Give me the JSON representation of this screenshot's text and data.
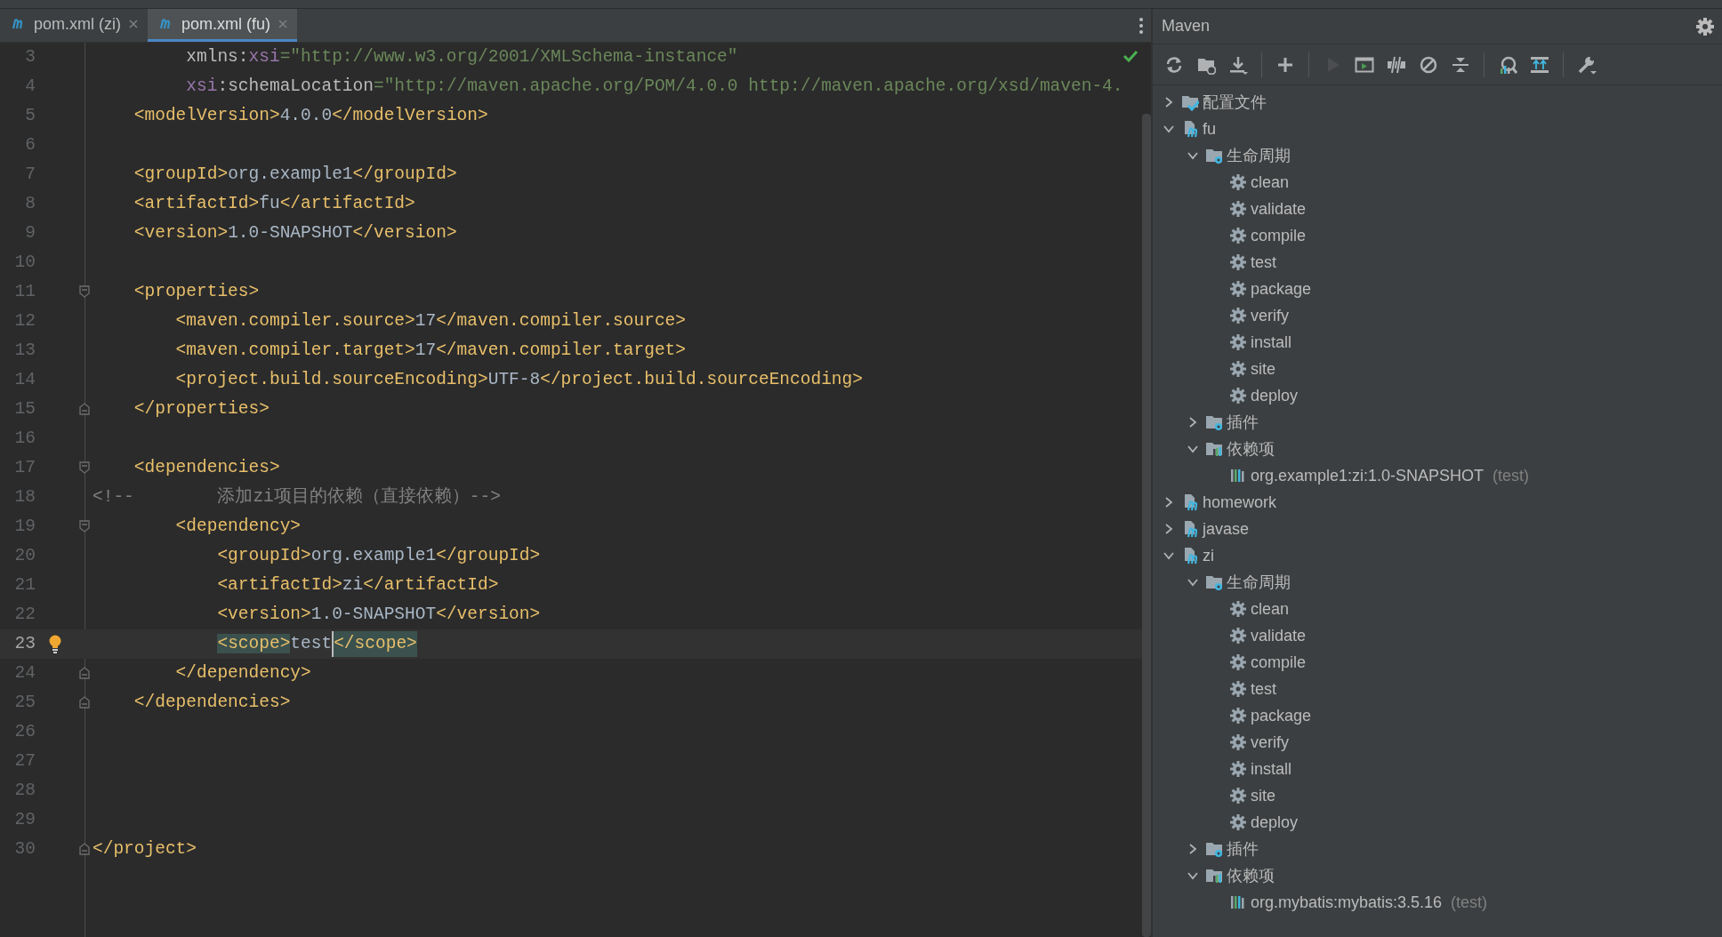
{
  "tabs": [
    {
      "label": "pom.xml (zi)",
      "selected": false
    },
    {
      "label": "pom.xml (fu)",
      "selected": true
    }
  ],
  "editor": {
    "lines": [
      {
        "number": "3",
        "tokens": [
          {
            "kind": "attr",
            "text": "         xmlns:"
          },
          {
            "kind": "ns",
            "text": "xsi"
          },
          {
            "kind": "str",
            "text": "=\"http://www.w3.org/2001/XMLSchema-instance\""
          }
        ]
      },
      {
        "number": "4",
        "tokens": [
          {
            "kind": "ns",
            "text": "         xsi"
          },
          {
            "kind": "attr",
            "text": ":schemaLocation"
          },
          {
            "kind": "str",
            "text": "=\"http://maven.apache.org/POM/4.0.0 http://maven.apache.org/xsd/maven-4."
          }
        ]
      },
      {
        "number": "5",
        "tokens": [
          {
            "kind": "tag",
            "text": "    <modelVersion>"
          },
          {
            "kind": "text",
            "text": "4.0.0"
          },
          {
            "kind": "tag",
            "text": "</modelVersion>"
          }
        ]
      },
      {
        "number": "6"
      },
      {
        "number": "7",
        "tokens": [
          {
            "kind": "tag",
            "text": "    <groupId>"
          },
          {
            "kind": "text",
            "text": "org.example1"
          },
          {
            "kind": "tag",
            "text": "</groupId>"
          }
        ]
      },
      {
        "number": "8",
        "tokens": [
          {
            "kind": "tag",
            "text": "    <artifactId>"
          },
          {
            "kind": "text",
            "text": "fu"
          },
          {
            "kind": "tag",
            "text": "</artifactId>"
          }
        ]
      },
      {
        "number": "9",
        "tokens": [
          {
            "kind": "tag",
            "text": "    <version>"
          },
          {
            "kind": "text",
            "text": "1.0-SNAPSHOT"
          },
          {
            "kind": "tag",
            "text": "</version>"
          }
        ]
      },
      {
        "number": "10"
      },
      {
        "number": "11",
        "fold_open": true,
        "tokens": [
          {
            "kind": "tag",
            "text": "    <properties>"
          }
        ]
      },
      {
        "number": "12",
        "tokens": [
          {
            "kind": "tag",
            "text": "        <maven.compiler.source>"
          },
          {
            "kind": "text",
            "text": "17"
          },
          {
            "kind": "tag",
            "text": "</maven.compiler.source>"
          }
        ]
      },
      {
        "number": "13",
        "tokens": [
          {
            "kind": "tag",
            "text": "        <maven.compiler.target>"
          },
          {
            "kind": "text",
            "text": "17"
          },
          {
            "kind": "tag",
            "text": "</maven.compiler.target>"
          }
        ]
      },
      {
        "number": "14",
        "tokens": [
          {
            "kind": "tag",
            "text": "        <project.build.sourceEncoding>"
          },
          {
            "kind": "text",
            "text": "UTF-8"
          },
          {
            "kind": "tag",
            "text": "</project.build.sourceEncoding>"
          }
        ]
      },
      {
        "number": "15",
        "fold_close": true,
        "tokens": [
          {
            "kind": "tag",
            "text": "    </properties>"
          }
        ]
      },
      {
        "number": "16"
      },
      {
        "number": "17",
        "fold_open": true,
        "tokens": [
          {
            "kind": "tag",
            "text": "    <dependencies>"
          }
        ]
      },
      {
        "number": "18",
        "tokens": [
          {
            "kind": "comment",
            "text": "<!--        添加zi项目的依赖（直接依赖）-->"
          }
        ]
      },
      {
        "number": "19",
        "fold_open": true,
        "tokens": [
          {
            "kind": "tag",
            "text": "        <dependency>"
          }
        ]
      },
      {
        "number": "20",
        "tokens": [
          {
            "kind": "tag",
            "text": "            <groupId>"
          },
          {
            "kind": "text",
            "text": "org.example1"
          },
          {
            "kind": "tag",
            "text": "</groupId>"
          }
        ]
      },
      {
        "number": "21",
        "tokens": [
          {
            "kind": "tag",
            "text": "            <artifactId>"
          },
          {
            "kind": "text",
            "text": "zi"
          },
          {
            "kind": "tag",
            "text": "</artifactId>"
          }
        ]
      },
      {
        "number": "22",
        "tokens": [
          {
            "kind": "tag",
            "text": "            <version>"
          },
          {
            "kind": "text",
            "text": "1.0-SNAPSHOT"
          },
          {
            "kind": "tag",
            "text": "</version>"
          }
        ]
      },
      {
        "number": "23",
        "current": true,
        "bulb": true,
        "tokens": [
          {
            "kind": "tag",
            "text": "            <scope>",
            "matched": true,
            "caret": false
          },
          {
            "kind": "text",
            "text": "test",
            "matched": false,
            "caret": true
          },
          {
            "kind": "tag",
            "text": "</scope>",
            "matched": true,
            "caret": false
          }
        ]
      },
      {
        "number": "24",
        "fold_close": true,
        "tokens": [
          {
            "kind": "tag",
            "text": "        </dependency>"
          }
        ]
      },
      {
        "number": "25",
        "fold_close": true,
        "tokens": [
          {
            "kind": "tag",
            "text": "    </dependencies>"
          }
        ]
      },
      {
        "number": "26"
      },
      {
        "number": "27"
      },
      {
        "number": "28"
      },
      {
        "number": "29"
      },
      {
        "number": "30",
        "fold_close": true,
        "tokens": [
          {
            "kind": "tag",
            "text": "</project>"
          }
        ]
      }
    ]
  },
  "maven": {
    "title": "Maven",
    "toolbar": [
      {
        "kind": "reload",
        "disabled": false
      },
      {
        "kind": "folder-sync",
        "disabled": false
      },
      {
        "kind": "download",
        "disabled": false
      },
      {
        "kind": "add",
        "disabled": false
      },
      {
        "kind": "run",
        "disabled": true
      },
      {
        "kind": "run-config",
        "disabled": false
      },
      {
        "kind": "offline",
        "disabled": false
      },
      {
        "kind": "skip-tests",
        "disabled": false
      },
      {
        "kind": "collapse",
        "disabled": false
      },
      {
        "kind": "analyze",
        "disabled": false
      },
      {
        "kind": "show-deps",
        "disabled": false
      },
      {
        "kind": "wrench",
        "disabled": false
      }
    ],
    "tree": [
      {
        "kind": "profiles",
        "label": "配置文件",
        "expanded": false
      },
      {
        "kind": "project",
        "label": "fu",
        "expanded": true,
        "children": [
          {
            "kind": "lifecycle",
            "label": "生命周期",
            "expanded": true,
            "children": [
              {
                "kind": "goal",
                "label": "clean"
              },
              {
                "kind": "goal",
                "label": "validate"
              },
              {
                "kind": "goal",
                "label": "compile"
              },
              {
                "kind": "goal",
                "label": "test"
              },
              {
                "kind": "goal",
                "label": "package"
              },
              {
                "kind": "goal",
                "label": "verify"
              },
              {
                "kind": "goal",
                "label": "install"
              },
              {
                "kind": "goal",
                "label": "site"
              },
              {
                "kind": "goal",
                "label": "deploy"
              }
            ]
          },
          {
            "kind": "plugins",
            "label": "插件",
            "expanded": false
          },
          {
            "kind": "dependencies",
            "label": "依赖项",
            "expanded": true,
            "children": [
              {
                "kind": "dependency",
                "label": "org.example1:zi:1.0-SNAPSHOT",
                "scope": "(test)"
              }
            ]
          }
        ]
      },
      {
        "kind": "project",
        "label": "homework",
        "expanded": false
      },
      {
        "kind": "project",
        "label": "javase",
        "expanded": false
      },
      {
        "kind": "project",
        "label": "zi",
        "expanded": true,
        "children": [
          {
            "kind": "lifecycle",
            "label": "生命周期",
            "expanded": true,
            "children": [
              {
                "kind": "goal",
                "label": "clean"
              },
              {
                "kind": "goal",
                "label": "validate"
              },
              {
                "kind": "goal",
                "label": "compile"
              },
              {
                "kind": "goal",
                "label": "test"
              },
              {
                "kind": "goal",
                "label": "package"
              },
              {
                "kind": "goal",
                "label": "verify"
              },
              {
                "kind": "goal",
                "label": "install"
              },
              {
                "kind": "goal",
                "label": "site"
              },
              {
                "kind": "goal",
                "label": "deploy"
              }
            ]
          },
          {
            "kind": "plugins",
            "label": "插件",
            "expanded": false
          },
          {
            "kind": "dependencies",
            "label": "依赖项",
            "expanded": true,
            "children": [
              {
                "kind": "dependency",
                "label": "org.mybatis:mybatis:3.5.16",
                "scope": "(test)"
              }
            ]
          }
        ]
      }
    ]
  }
}
